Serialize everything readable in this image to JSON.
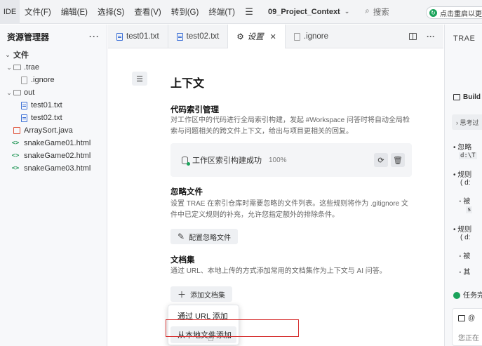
{
  "menubar": {
    "ide": "IDE",
    "menus": [
      "文件(F)",
      "编辑(E)",
      "选择(S)",
      "查看(V)",
      "转到(G)",
      "终端(T)"
    ],
    "project": "09_Project_Context",
    "search": "搜索",
    "restart": "点击重启以更新"
  },
  "sidebar": {
    "title": "资源管理器",
    "more": "···",
    "tree": [
      {
        "label": "文件",
        "level": 0,
        "type": "root"
      },
      {
        "label": ".trae",
        "level": 1,
        "type": "folder"
      },
      {
        "label": ".ignore",
        "level": 2,
        "type": "file"
      },
      {
        "label": "out",
        "level": 1,
        "type": "folder"
      },
      {
        "label": "test01.txt",
        "level": 2,
        "type": "txt"
      },
      {
        "label": "test02.txt",
        "level": 2,
        "type": "txt"
      },
      {
        "label": "ArraySort.java",
        "level": 1,
        "type": "java"
      },
      {
        "label": "snakeGame01.html",
        "level": 1,
        "type": "html"
      },
      {
        "label": "snakeGame02.html",
        "level": 1,
        "type": "html"
      },
      {
        "label": "snakeGame03.html",
        "level": 1,
        "type": "html"
      }
    ]
  },
  "tabs": [
    {
      "label": "test01.txt",
      "icon": "txt"
    },
    {
      "label": "test02.txt",
      "icon": "txt"
    },
    {
      "label": "设置",
      "icon": "gear",
      "active": true
    },
    {
      "label": ".ignore",
      "icon": "file"
    }
  ],
  "settings": {
    "title": "上下文",
    "index": {
      "title": "代码索引管理",
      "desc": "对工作区中的代码进行全局索引构建，发起 #Workspace 问答时将自动全局检索与问题相关的跨文件上下文，给出与项目更相关的回复。",
      "status": "工作区索引构建成功",
      "percent": "100%"
    },
    "ignore": {
      "title": "忽略文件",
      "desc": "设置 TRAE 在索引仓库时需要忽略的文件列表。这些规则将作为 .gitignore 文件中已定义规则的补充，允许您指定额外的排除条件。",
      "button": "配置忽略文件"
    },
    "docs": {
      "title": "文档集",
      "desc": "通过 URL、本地上传的方式添加常用的文档集作为上下文与 AI 问答。",
      "button": "添加文档集",
      "menu": [
        "通过 URL 添加",
        "从本地文件添加"
      ]
    }
  },
  "chat": {
    "title": "TRAE",
    "build": "Build",
    "think": "思考过",
    "lines": [
      "忽略",
      "d:\\T",
      "规则",
      "( d:",
      "被",
      "s",
      "规则",
      "( d:",
      "被",
      "其"
    ],
    "done": "任务完",
    "at": "@",
    "working": "您正在"
  }
}
